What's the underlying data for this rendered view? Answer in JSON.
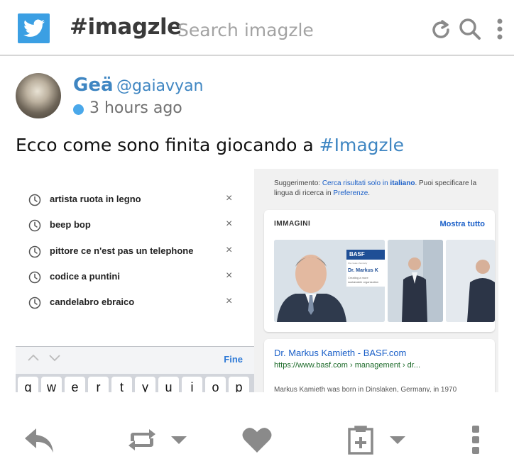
{
  "header": {
    "brand": "#imagzle",
    "search_placeholder": "Search imagzle",
    "icons": [
      "twitter-bird-icon",
      "refresh-icon",
      "search-icon",
      "more-vertical-icon"
    ]
  },
  "post": {
    "author_name": "Geä",
    "author_handle": "@gaiavyan",
    "timestamp": "3 hours ago",
    "text": "Ecco come sono finita giocando a ",
    "hashtag": "#Imagzle"
  },
  "embed": {
    "suggestions": [
      "artista ruota in legno",
      "beep bop",
      "pittore ce n'est pas un telephone",
      "codice a puntini",
      "candelabro ebraico"
    ],
    "remove_symbol": "×",
    "keyboard_done": "Fine",
    "keyboard_keys": [
      "q",
      "w",
      "e",
      "r",
      "t",
      "y",
      "u",
      "i",
      "o",
      "p"
    ],
    "hint_prefix": "Suggerimento: ",
    "hint_link1": "Cerca risultati solo in ",
    "hint_link1_bold": "italiano",
    "hint_mid": ". Puoi specificare la lingua di ricerca in ",
    "hint_link2": "Preferenze",
    "hint_end": ".",
    "images_title": "IMMAGINI",
    "images_more": "Mostra tutto",
    "badge_brand": "BASF",
    "badge_tagline": "We create chemistry",
    "badge_name": "Dr. Markus K",
    "badge_caption": "Creating a more sustainable organization",
    "result_title": "Dr. Markus Kamieth - BASF.com",
    "result_url": "https://www.basf.com › management › dr...",
    "result_snippet": "Markus Kamieth was born in Dinslaken, Germany, in 1970"
  },
  "actions": [
    "reply-icon",
    "retweet-icon",
    "retweet-menu-chevron-icon",
    "like-heart-icon",
    "add-to-clipboard-icon",
    "clipboard-menu-chevron-icon",
    "more-vertical-icon"
  ],
  "colors": {
    "brand_blue": "#3b9fe3",
    "link_blue": "#3f86c2",
    "icon_gray": "#8a8a8a"
  }
}
